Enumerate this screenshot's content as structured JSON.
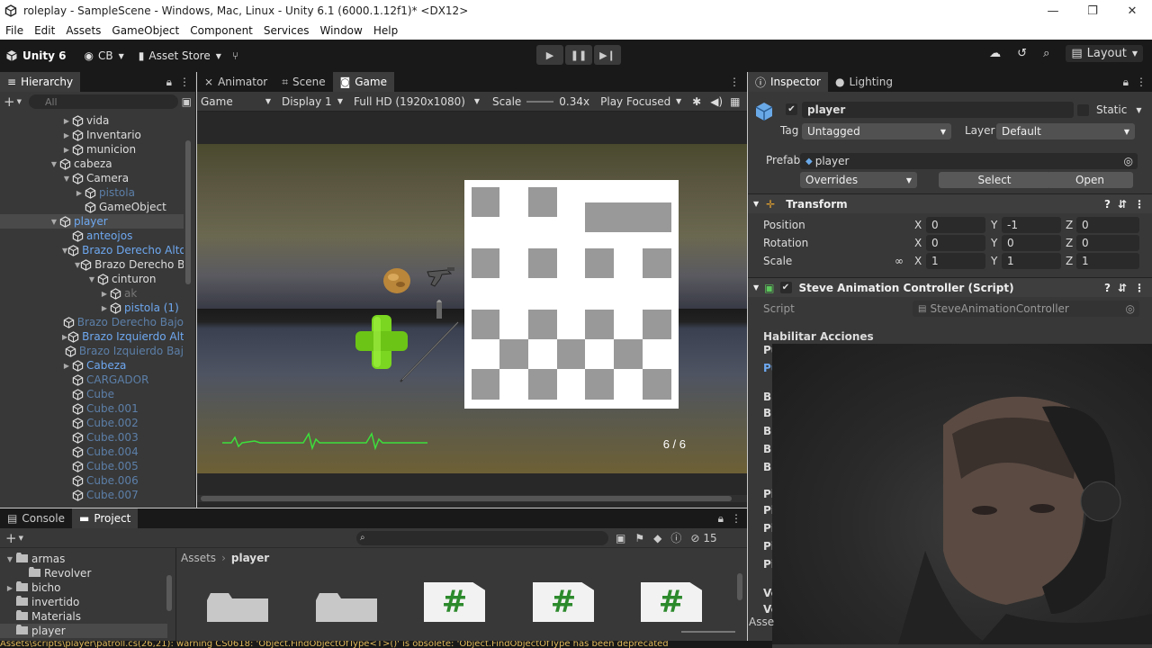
{
  "window": {
    "title": "roleplay - SampleScene - Windows, Mac, Linux - Unity 6.1 (6000.1.12f1)* <DX12>",
    "controls": [
      "—",
      "❐",
      "✕"
    ]
  },
  "menu": [
    "File",
    "Edit",
    "Assets",
    "GameObject",
    "Component",
    "Services",
    "Window",
    "Help"
  ],
  "toolbar": {
    "unity_label": "Unity 6",
    "account": "CB",
    "asset_store": "Asset Store",
    "layout": "Layout"
  },
  "hierarchy": {
    "tab": "Hierarchy",
    "search_placeholder": "All",
    "rows": [
      {
        "label": "vida",
        "indent": 5,
        "arrow": "▶",
        "style": "normal"
      },
      {
        "label": "Inventario",
        "indent": 5,
        "arrow": "▶",
        "style": "normal"
      },
      {
        "label": "municion",
        "indent": 5,
        "arrow": "▶",
        "style": "normal"
      },
      {
        "label": "cabeza",
        "indent": 4,
        "arrow": "▼",
        "style": "normal"
      },
      {
        "label": "Camera",
        "indent": 5,
        "arrow": "▼",
        "style": "normal"
      },
      {
        "label": "pistola",
        "indent": 6,
        "arrow": "▶",
        "style": "dim"
      },
      {
        "label": "GameObject",
        "indent": 6,
        "arrow": "",
        "style": "normal"
      },
      {
        "label": "player",
        "indent": 4,
        "arrow": "▼",
        "style": "blue",
        "selected": true
      },
      {
        "label": "anteojos",
        "indent": 5,
        "arrow": "",
        "style": "blue"
      },
      {
        "label": "Brazo Derecho Alto",
        "indent": 5,
        "arrow": "▼",
        "style": "blue"
      },
      {
        "label": "Brazo Derecho Ba",
        "indent": 6,
        "arrow": "▼",
        "style": "normal"
      },
      {
        "label": "cinturon",
        "indent": 7,
        "arrow": "▼",
        "style": "normal"
      },
      {
        "label": "ak",
        "indent": 8,
        "arrow": "▶",
        "style": "grey"
      },
      {
        "label": "pistola (1)",
        "indent": 8,
        "arrow": "▶",
        "style": "blue"
      },
      {
        "label": "Brazo Derecho Bajo",
        "indent": 5,
        "arrow": "",
        "style": "dim"
      },
      {
        "label": "Brazo Izquierdo Alto",
        "indent": 5,
        "arrow": "▶",
        "style": "blue"
      },
      {
        "label": "Brazo Izquierdo Baj",
        "indent": 5,
        "arrow": "",
        "style": "dim"
      },
      {
        "label": "Cabeza",
        "indent": 5,
        "arrow": "▶",
        "style": "blue"
      },
      {
        "label": "CARGADOR",
        "indent": 5,
        "arrow": "",
        "style": "dim"
      },
      {
        "label": "Cube",
        "indent": 5,
        "arrow": "",
        "style": "dim"
      },
      {
        "label": "Cube.001",
        "indent": 5,
        "arrow": "",
        "style": "dim"
      },
      {
        "label": "Cube.002",
        "indent": 5,
        "arrow": "",
        "style": "dim"
      },
      {
        "label": "Cube.003",
        "indent": 5,
        "arrow": "",
        "style": "dim"
      },
      {
        "label": "Cube.004",
        "indent": 5,
        "arrow": "",
        "style": "dim"
      },
      {
        "label": "Cube.005",
        "indent": 5,
        "arrow": "",
        "style": "dim"
      },
      {
        "label": "Cube.006",
        "indent": 5,
        "arrow": "",
        "style": "dim"
      },
      {
        "label": "Cube.007",
        "indent": 5,
        "arrow": "",
        "style": "dim"
      }
    ]
  },
  "center": {
    "tabs": [
      {
        "label": "Animator",
        "active": false
      },
      {
        "label": "Scene",
        "active": false
      },
      {
        "label": "Game",
        "active": true
      }
    ],
    "game_toolbar": {
      "mode": "Game",
      "display": "Display 1",
      "resolution": "Full HD (1920x1080)",
      "scale_label": "Scale",
      "scale_value": "0.34x",
      "play_mode": "Play Focused"
    },
    "hud": {
      "ammo": "6 / 6"
    }
  },
  "inspector": {
    "tabs": [
      {
        "label": "Inspector",
        "active": true
      },
      {
        "label": "Lighting",
        "active": false
      }
    ],
    "object_name": "player",
    "static_label": "Static",
    "tag_label": "Tag",
    "tag_value": "Untagged",
    "layer_label": "Layer",
    "layer_value": "Default",
    "prefab_label": "Prefab",
    "prefab_value": "player",
    "overrides": "Overrides",
    "select": "Select",
    "open": "Open",
    "transform": {
      "title": "Transform",
      "position_label": "Position",
      "rotation_label": "Rotation",
      "scale_label": "Scale",
      "position": {
        "x": "0",
        "y": "-1",
        "z": "0"
      },
      "rotation": {
        "x": "0",
        "y": "0",
        "z": "0"
      },
      "scale": {
        "x": "1",
        "y": "1",
        "z": "1"
      }
    },
    "script_component": {
      "title": "Steve Animation Controller (Script)",
      "script_label": "Script",
      "script_value": "SteveAnimationController",
      "section": "Habilitar Acciones",
      "partial_labels": [
        "Pu",
        "Pu",
        "Br",
        "Br",
        "Br",
        "Br",
        "Br",
        "Pi",
        "Pi",
        "Pi",
        "Pi",
        "Pi",
        "Ve",
        "Ve"
      ]
    }
  },
  "project": {
    "tabs": [
      {
        "label": "Console",
        "active": false
      },
      {
        "label": "Project",
        "active": true
      }
    ],
    "hidden_count": "15",
    "tree": [
      {
        "label": "armas",
        "indent": 1,
        "arrow": "▼"
      },
      {
        "label": "Revolver",
        "indent": 2,
        "arrow": ""
      },
      {
        "label": "bicho",
        "indent": 1,
        "arrow": "▶"
      },
      {
        "label": "invertido",
        "indent": 1,
        "arrow": ""
      },
      {
        "label": "Materials",
        "indent": 1,
        "arrow": ""
      },
      {
        "label": "player",
        "indent": 1,
        "arrow": "",
        "selected": true
      }
    ],
    "breadcrumb": [
      "Assets",
      "player"
    ],
    "asset_partial_label": "Asse"
  },
  "status": {
    "message": "Assets\\scripts\\player\\patroll.cs(26,21): warning CS0618: 'Object.FindObjectOfType<T>()' is obsolete: 'Object.FindObjectOfType has been deprecated"
  },
  "colors": {
    "accent": "#4a88d8",
    "panel": "#383838",
    "dark": "#191919",
    "heartbeat": "#3ce03c"
  }
}
